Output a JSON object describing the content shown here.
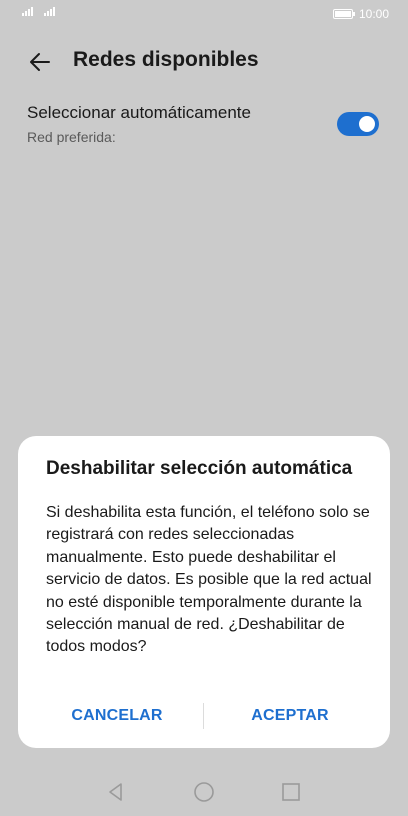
{
  "status_bar": {
    "time": "10:00",
    "icons": [
      "signal-icon",
      "signal-icon",
      "battery-icon"
    ]
  },
  "header": {
    "back_icon": "back-arrow-icon",
    "title": "Redes disponibles"
  },
  "auto_select": {
    "label": "Seleccionar automáticamente",
    "sublabel": "Red preferida:",
    "toggle_on": true,
    "accent_color": "#1e6fcf"
  },
  "dialog": {
    "title": "Deshabilitar selección automática",
    "message": "Si deshabilita esta función, el teléfono solo se registrará con redes seleccionadas manualmente. Esto puede deshabilitar el servicio de datos. Es posible que la red actual no esté disponible temporalmente durante la selección manual de red. ¿Deshabilitar de todos modos?",
    "cancel_label": "CANCELAR",
    "accept_label": "ACEPTAR"
  },
  "nav_bar": {
    "icons": [
      "nav-back-icon",
      "nav-home-icon",
      "nav-recent-icon"
    ]
  }
}
